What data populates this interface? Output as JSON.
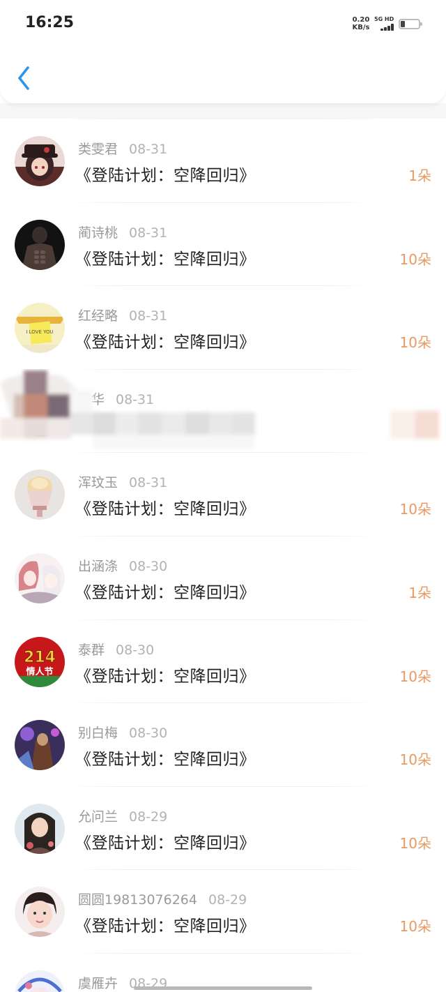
{
  "status_bar": {
    "time": "16:25",
    "net_speed_value": "0.20",
    "net_speed_unit": "KB/s",
    "network": "5G HD"
  },
  "header": {
    "back_icon": "chevron-left-icon",
    "accent": "#2b95ec"
  },
  "colors": {
    "count": "#e89a62",
    "title": "#222222",
    "name": "#9a9a9a"
  },
  "rows": [
    {
      "name": "类雯君",
      "date": "08-31",
      "title": "《登陆计划：空降回归》",
      "count": "1朵"
    },
    {
      "name": "蔺诗桃",
      "date": "08-31",
      "title": "《登陆计划：空降回归》",
      "count": "10朵"
    },
    {
      "name": "红经略",
      "date": "08-31",
      "title": "《登陆计划：空降回归》",
      "count": "10朵",
      "avatar_text": "I LOVE YOU"
    },
    {
      "name": "苗华",
      "date": "08-31",
      "title": "",
      "count": "",
      "blurred": true
    },
    {
      "name": "浑玟玉",
      "date": "08-31",
      "title": "《登陆计划：空降回归》",
      "count": "10朵"
    },
    {
      "name": "出涵涤",
      "date": "08-30",
      "title": "《登陆计划：空降回归》",
      "count": "1朵"
    },
    {
      "name": "泰群",
      "date": "08-30",
      "title": "《登陆计划：空降回归》",
      "count": "10朵",
      "avatar_text": "214",
      "avatar_subtext": "情人节"
    },
    {
      "name": "别白梅",
      "date": "08-30",
      "title": "《登陆计划：空降回归》",
      "count": "10朵"
    },
    {
      "name": "允问兰",
      "date": "08-29",
      "title": "《登陆计划：空降回归》",
      "count": "10朵"
    },
    {
      "name": "圆圆19813076264",
      "date": "08-29",
      "title": "《登陆计划：空降回归》",
      "count": "10朵"
    },
    {
      "name": "虞雁卉",
      "date": "08-29",
      "title": "",
      "count": ""
    }
  ]
}
